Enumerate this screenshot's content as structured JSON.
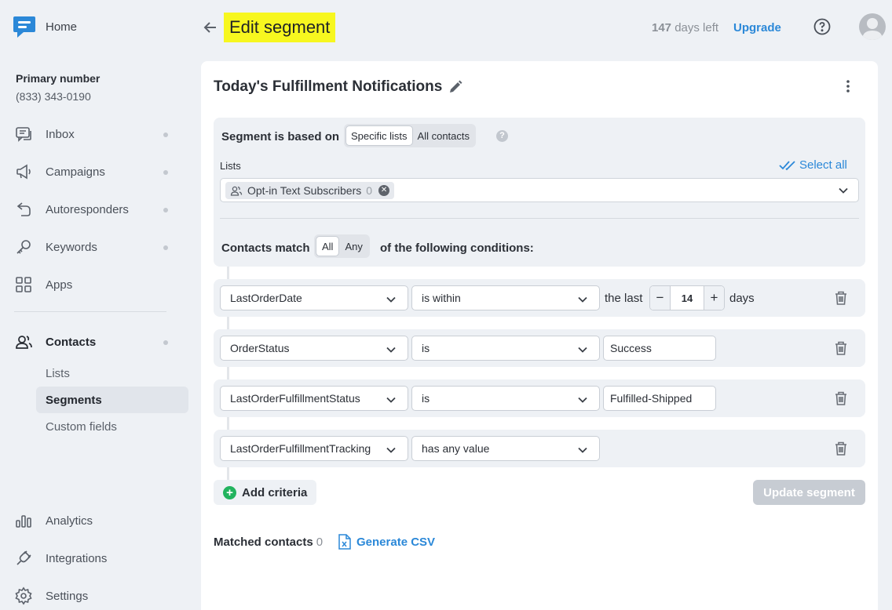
{
  "sidebar": {
    "home_label": "Home",
    "primary_label": "Primary number",
    "phone": "(833) 343-0190",
    "items": [
      {
        "label": "Inbox",
        "icon": "inbox-icon"
      },
      {
        "label": "Campaigns",
        "icon": "megaphone-icon"
      },
      {
        "label": "Autoresponders",
        "icon": "autoresponder-icon"
      },
      {
        "label": "Keywords",
        "icon": "key-icon"
      },
      {
        "label": "Apps",
        "icon": "apps-grid-icon"
      },
      {
        "label": "Contacts",
        "icon": "contacts-icon"
      }
    ],
    "contacts_sub": [
      {
        "label": "Lists"
      },
      {
        "label": "Segments"
      },
      {
        "label": "Custom fields"
      }
    ],
    "bottom": [
      {
        "label": "Analytics",
        "icon": "bar-chart-icon"
      },
      {
        "label": "Integrations",
        "icon": "plug-icon"
      },
      {
        "label": "Settings",
        "icon": "gear-icon"
      }
    ]
  },
  "header": {
    "title": "Edit segment",
    "days_count": "147",
    "days_text": "days left",
    "upgrade": "Upgrade"
  },
  "segment": {
    "name": "Today's Fulfillment Notifications",
    "based_label": "Segment is based on",
    "based_options": [
      "Specific lists",
      "All contacts"
    ],
    "lists_label": "Lists",
    "select_all": "Select all",
    "list_chip": {
      "label": "Opt-in Text Subscribers",
      "count": "0"
    },
    "match_label": "Contacts match",
    "match_options": [
      "All",
      "Any"
    ],
    "match_suffix": "of the following conditions:",
    "criteria": [
      {
        "field": "LastOrderDate",
        "op": "is within",
        "prefix": "the last",
        "value": "14",
        "suffix": "days"
      },
      {
        "field": "OrderStatus",
        "op": "is",
        "value": "Success"
      },
      {
        "field": "LastOrderFulfillmentStatus",
        "op": "is",
        "value": "Fulfilled-Shipped"
      },
      {
        "field": "LastOrderFulfillmentTracking",
        "op": "has any value"
      }
    ],
    "add_criteria": "Add criteria",
    "update_segment": "Update segment",
    "matched_label": "Matched contacts",
    "matched_count": "0",
    "generate_csv": "Generate CSV"
  },
  "colors": {
    "accent": "#2b88d8",
    "highlight": "#f7f71f",
    "add_green": "#22b35e"
  }
}
